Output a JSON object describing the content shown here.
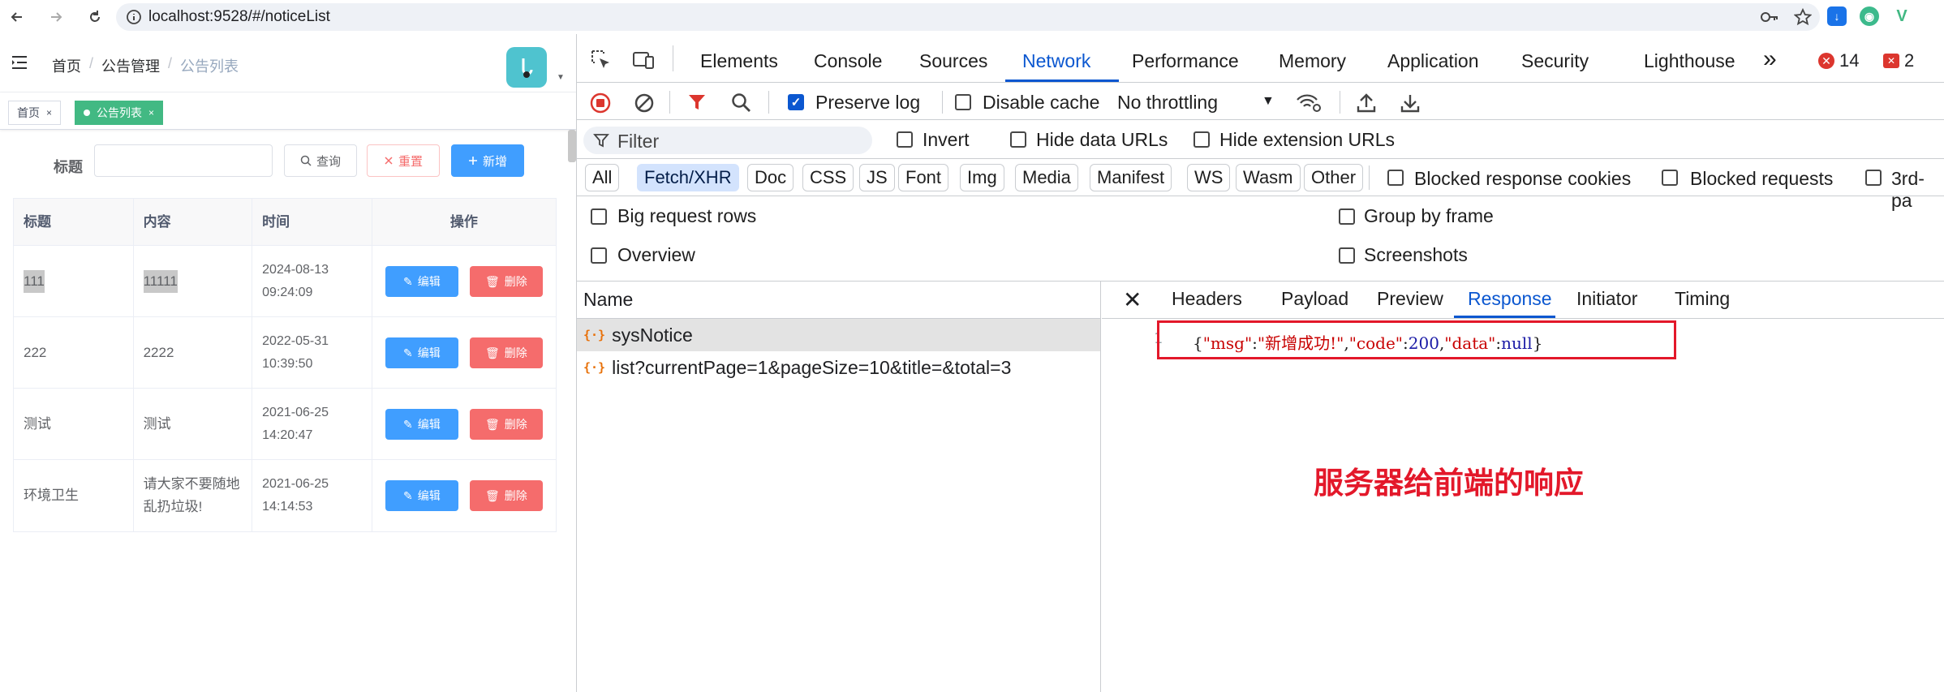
{
  "browser": {
    "url": "localhost:9528/#/noticeList"
  },
  "app": {
    "breadcrumb": [
      "首页",
      "公告管理",
      "公告列表"
    ],
    "breadcrumb_sep": "/",
    "tags": [
      {
        "label": "首页",
        "close": "×"
      },
      {
        "label": "公告列表",
        "close": "×"
      }
    ],
    "form": {
      "title_label": "标题",
      "title_value": "",
      "search_label": "查询",
      "reset_label": "重置",
      "add_label": "新增"
    },
    "table": {
      "headers": [
        "标题",
        "内容",
        "时间",
        "操作"
      ],
      "rows": [
        {
          "title": "111",
          "content": "11111",
          "time": "2024-08-13 09:24:09"
        },
        {
          "title": "222",
          "content": "2222",
          "time": "2022-05-31 10:39:50"
        },
        {
          "title": "测试",
          "content": "测试",
          "time": "2021-06-25 14:20:47"
        },
        {
          "title": "环境卫生",
          "content": "请大家不要随地乱扔垃圾!",
          "time": "2021-06-25 14:14:53"
        }
      ],
      "edit_label": "编辑",
      "delete_label": "删除"
    }
  },
  "devtools": {
    "tabs": [
      "Elements",
      "Console",
      "Sources",
      "Network",
      "Performance",
      "Memory",
      "Application",
      "Security",
      "Lighthouse"
    ],
    "active_tab": "Network",
    "more_tabs": "»",
    "error_count": "14",
    "issue_count": "2",
    "toolbar": {
      "preserve_log": "Preserve log",
      "disable_cache": "Disable cache",
      "throttling": "No throttling"
    },
    "filter": {
      "placeholder": "Filter",
      "invert": "Invert",
      "hide_data_urls": "Hide data URLs",
      "hide_extension_urls": "Hide extension URLs"
    },
    "types": [
      "All",
      "Fetch/XHR",
      "Doc",
      "CSS",
      "JS",
      "Font",
      "Img",
      "Media",
      "Manifest",
      "WS",
      "Wasm",
      "Other"
    ],
    "active_type": "Fetch/XHR",
    "type_options": {
      "blocked_cookies": "Blocked response cookies",
      "blocked_requests": "Blocked requests",
      "third_party": "3rd-pa"
    },
    "options": {
      "big_request_rows": "Big request rows",
      "group_by_frame": "Group by frame",
      "overview": "Overview",
      "screenshots": "Screenshots"
    },
    "name_header": "Name",
    "requests": [
      {
        "name": "sysNotice",
        "selected": true
      },
      {
        "name": "list?currentPage=1&pageSize=10&title=&total=3",
        "selected": false
      }
    ],
    "detail_tabs": [
      "Headers",
      "Payload",
      "Preview",
      "Response",
      "Initiator",
      "Timing"
    ],
    "active_detail_tab": "Response",
    "response": {
      "line_number": "1",
      "open": "{",
      "k1": "\"msg\"",
      "v1": "\"新增成功!\"",
      "k2": "\"code\"",
      "v2": "200",
      "k3": "\"data\"",
      "v3": "null",
      "close": "}"
    },
    "annotation": "服务器给前端的响应"
  },
  "colors": {
    "primary": "#409eff",
    "danger": "#f56c6c",
    "tag_active": "#42b983",
    "devtools_accent": "#0b57d0",
    "annotation_red": "#e3182a"
  }
}
